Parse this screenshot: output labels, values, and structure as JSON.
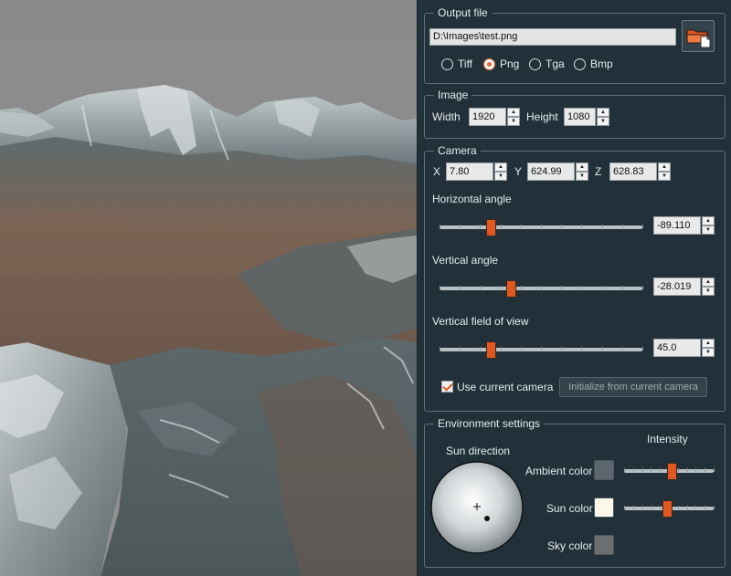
{
  "output_file": {
    "title": "Output file",
    "path": "D:\\Images\\test.png",
    "formats": [
      {
        "label": "Tiff",
        "selected": false
      },
      {
        "label": "Png",
        "selected": true
      },
      {
        "label": "Tga",
        "selected": false
      },
      {
        "label": "Bmp",
        "selected": false
      }
    ],
    "browse_icon": "folder-open-icon"
  },
  "image": {
    "title": "Image",
    "width_label": "Width",
    "width": "1920",
    "height_label": "Height",
    "height": "1080"
  },
  "camera": {
    "title": "Camera",
    "x_label": "X",
    "x": "7.80",
    "y_label": "Y",
    "y": "624.99",
    "z_label": "Z",
    "z": "628.83",
    "horizontal_angle": {
      "label": "Horizontal angle",
      "value": "-89.110",
      "slider_fraction": 0.25
    },
    "vertical_angle": {
      "label": "Vertical angle",
      "value": "-28.019",
      "slider_fraction": 0.35
    },
    "vertical_fov": {
      "label": "Vertical field of view",
      "value": "45.0",
      "slider_fraction": 0.25
    },
    "use_current_camera": {
      "label": "Use current camera",
      "checked": true
    },
    "init_button": "Initialize from current camera"
  },
  "environment": {
    "title": "Environment settings",
    "sun_direction_label": "Sun direction",
    "intensity_label": "Intensity",
    "ambient": {
      "label": "Ambient color",
      "color": "#5d6770",
      "intensity_fraction": 0.53
    },
    "sun": {
      "label": "Sun color",
      "color": "#fbf8ea",
      "intensity_fraction": 0.48
    },
    "sky": {
      "label": "Sky color",
      "color": "#6c6e70"
    }
  },
  "colors": {
    "accent": "#e0571f",
    "panel_bg": "#213039",
    "viewport_sky": "#8a8a8a"
  }
}
